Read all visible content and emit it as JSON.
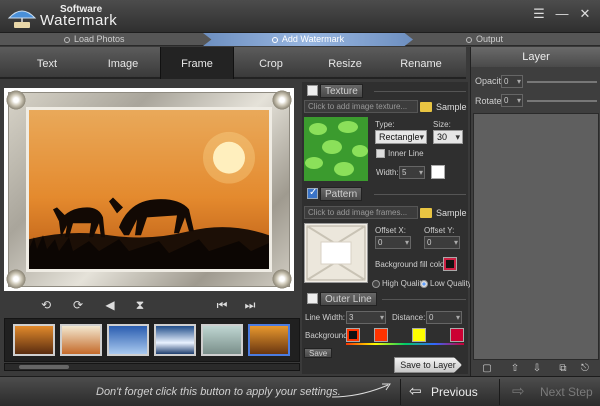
{
  "app": {
    "title_small": "Software",
    "title_big": "Watermark"
  },
  "window": {
    "menu_icon": "menu-icon",
    "minimize": "—",
    "close": "✕"
  },
  "steps": [
    {
      "label": "Load Photos",
      "active": false
    },
    {
      "label": "Add Watermark",
      "active": true
    },
    {
      "label": "Output",
      "active": false
    }
  ],
  "tabs": [
    {
      "label": "Text",
      "active": false
    },
    {
      "label": "Image",
      "active": false
    },
    {
      "label": "Frame",
      "active": true
    },
    {
      "label": "Crop",
      "active": false
    },
    {
      "label": "Resize",
      "active": false
    },
    {
      "label": "Rename",
      "active": false
    }
  ],
  "texture": {
    "enabled": false,
    "title": "Texture",
    "placeholder": "Click to add image texture...",
    "sample": "Sample",
    "type_label": "Type:",
    "type_value": "Rectangle",
    "size_label": "Size:",
    "size_value": "30",
    "inner_line_label": "Inner Line",
    "width_label": "Width:",
    "width_value": "5",
    "swatch_color": "#ffffff",
    "preview_color": "#3b9b2e"
  },
  "pattern": {
    "enabled": true,
    "title": "Pattern",
    "placeholder": "Click to add image frames...",
    "sample": "Sample",
    "offset_x_label": "Offset X:",
    "offset_x_value": "0",
    "offset_y_label": "Offset Y:",
    "offset_y_value": "0",
    "bg_fill_label": "Background fill color:",
    "high_quality": "High Quality",
    "low_quality": "Low Quality",
    "quality_selected": "Low Quality"
  },
  "outer_line": {
    "enabled": false,
    "title": "Outer Line",
    "line_width_label": "Line Width:",
    "line_width_value": "3",
    "distance_label": "Distance:",
    "distance_value": "0",
    "background_label": "Background",
    "colors": [
      "#ff3300",
      "#ffff00",
      "#cc0033"
    ]
  },
  "save_section_label": "Save",
  "save_to_layer": "Save to Layer",
  "layer": {
    "title": "Layer",
    "opacity_label": "Opacity",
    "opacity_value": "0",
    "rotate_label": "Rotate",
    "rotate_value": "0"
  },
  "toolbar_icons": [
    "rotate-left-icon",
    "rotate-right-icon",
    "flip-horizontal-icon",
    "flip-vertical-icon",
    "previous-image-icon",
    "next-image-icon"
  ],
  "thumbnails": [
    "sunset-thumb",
    "poster-thumb",
    "ice-thumb",
    "lake-thumb",
    "animals-thumb",
    "zebras-thumb"
  ],
  "bottom": {
    "hint": "Don't forget click this button to apply your settings.",
    "previous_step": "Previous Step",
    "next_step": "Next Step"
  }
}
